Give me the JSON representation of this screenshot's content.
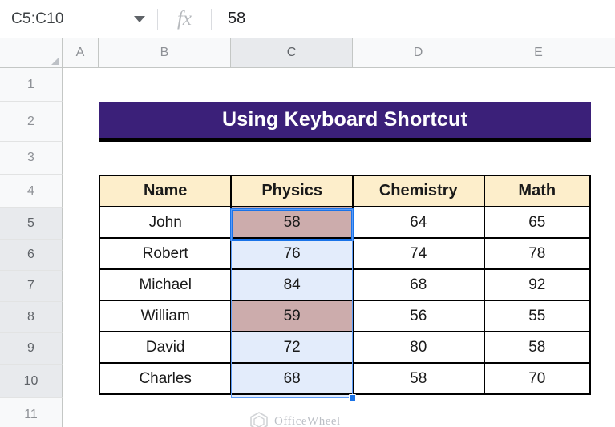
{
  "formula_bar": {
    "name_box_value": "C5:C10",
    "dropdown_icon": "chevron-down-icon",
    "fx_icon": "fx-icon",
    "fx_label": "fx",
    "formula_value": "58"
  },
  "grid": {
    "column_headers": [
      "A",
      "B",
      "C",
      "D",
      "E"
    ],
    "selected_column": "C",
    "row_headers": [
      "1",
      "2",
      "3",
      "4",
      "5",
      "6",
      "7",
      "8",
      "9",
      "10",
      "11"
    ],
    "selected_rows": [
      "5",
      "6",
      "7",
      "8",
      "9",
      "10"
    ]
  },
  "report": {
    "title": "Using Keyboard Shortcut",
    "title_bg": "#3b2079",
    "header_bg": "#fdeecb",
    "highlight_rose": "#ccacac",
    "selection_blue": "#e3ecfb",
    "active_border": "#1a73e8",
    "table": {
      "columns": [
        "Name",
        "Physics",
        "Chemistry",
        "Math"
      ],
      "rows": [
        {
          "name": "John",
          "physics": "58",
          "chemistry": "64",
          "math": "65",
          "physics_highlight": "rose"
        },
        {
          "name": "Robert",
          "physics": "76",
          "chemistry": "74",
          "math": "78",
          "physics_highlight": "blue"
        },
        {
          "name": "Michael",
          "physics": "84",
          "chemistry": "68",
          "math": "92",
          "physics_highlight": "blue"
        },
        {
          "name": "William",
          "physics": "59",
          "chemistry": "56",
          "math": "55",
          "physics_highlight": "rose"
        },
        {
          "name": "David",
          "physics": "72",
          "chemistry": "80",
          "math": "58",
          "physics_highlight": "blue"
        },
        {
          "name": "Charles",
          "physics": "68",
          "chemistry": "58",
          "math": "70",
          "physics_highlight": "blue"
        }
      ]
    }
  },
  "watermark": {
    "text": "OfficeWheel",
    "logo_icon": "hexagon-logo-icon"
  }
}
